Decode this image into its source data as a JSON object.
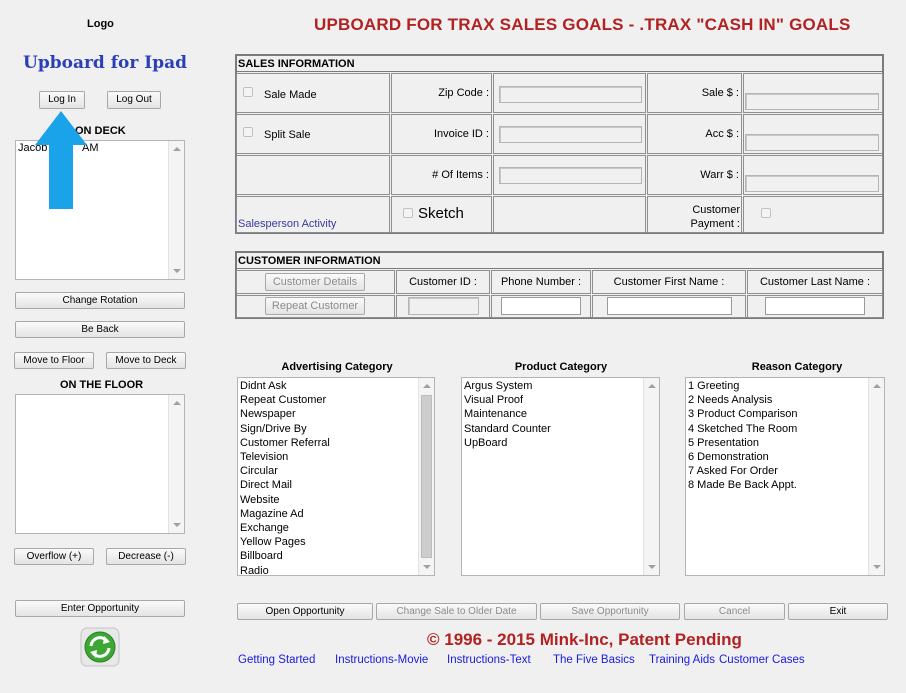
{
  "sidebar": {
    "logo": "Logo",
    "app_title": "Upboard for Ipad",
    "login_button": "Log In",
    "logout_button": "Log Out",
    "on_deck_title": "ON DECK",
    "on_deck_items": [
      "Jacob",
      "AM"
    ],
    "change_rotation_button": "Change Rotation",
    "be_back_button": "Be Back",
    "move_to_floor_button": "Move to Floor",
    "move_to_deck_button": "Move to Deck",
    "on_the_floor_title": "ON THE FLOOR",
    "overflow_button": "Overflow (+)",
    "decrease_button": "Decrease (-)",
    "enter_opportunity_button": "Enter Opportunity"
  },
  "header": {
    "title": "UPBOARD FOR TRAX SALES GOALS - .TRAX \"CASH IN\" GOALS"
  },
  "sales": {
    "section_title": "SALES INFORMATION",
    "sale_made_label": "Sale Made",
    "split_sale_label": "Split Sale",
    "zip_code_label": "Zip Code :",
    "invoice_id_label": "Invoice ID :",
    "items_label": "# Of Items :",
    "sale_amount_label": "Sale $ :",
    "acc_label": "Acc $ :",
    "warr_label": "Warr $ :",
    "salesperson_activity_link": "Salesperson Activity",
    "sketch_label": "Sketch",
    "customer_payment_label_1": "Customer",
    "customer_payment_label_2": "Payment :"
  },
  "customer": {
    "section_title": "CUSTOMER INFORMATION",
    "customer_details_button": "Customer Details",
    "repeat_customer_button": "Repeat Customer",
    "customer_id_label": "Customer ID :",
    "phone_label": "Phone Number :",
    "first_name_label": "Customer First Name :",
    "last_name_label": "Customer Last Name :"
  },
  "categories": {
    "advertising": {
      "title": "Advertising Category",
      "items": [
        "Didnt Ask",
        "Repeat Customer",
        "Newspaper",
        "Sign/Drive By",
        "Customer Referral",
        "Television",
        "Circular",
        "Direct Mail",
        "Website",
        "Magazine Ad",
        "Exchange",
        "Yellow Pages",
        "Billboard",
        "Radio"
      ]
    },
    "product": {
      "title": "Product Category",
      "items": [
        "Argus System",
        "Visual Proof",
        "Maintenance",
        "Standard Counter",
        "UpBoard"
      ]
    },
    "reason": {
      "title": "Reason Category",
      "items": [
        "1 Greeting",
        "2 Needs Analysis",
        "3 Product Comparison",
        "4 Sketched The Room",
        "5 Presentation",
        "6 Demonstration",
        "7 Asked For Order",
        "8 Made Be Back Appt."
      ]
    }
  },
  "actions": {
    "open_opportunity": "Open Opportunity",
    "change_sale": "Change  Sale to Older Date",
    "save_opportunity": "Save Opportunity",
    "cancel": "Cancel",
    "exit": "Exit"
  },
  "footer": {
    "copyright": "© 1996 - 2015 Mink-Inc, Patent Pending",
    "links": [
      "Getting Started",
      "Instructions-Movie",
      "Instructions-Text",
      "The Five Basics",
      "Training Aids",
      "Customer Cases"
    ]
  },
  "colors": {
    "title_red": "#b22222",
    "app_blue": "#2a3fb8",
    "link_blue": "#1a1adc",
    "arrow_blue": "#1aa3e8",
    "refresh_green": "#3aa833"
  }
}
